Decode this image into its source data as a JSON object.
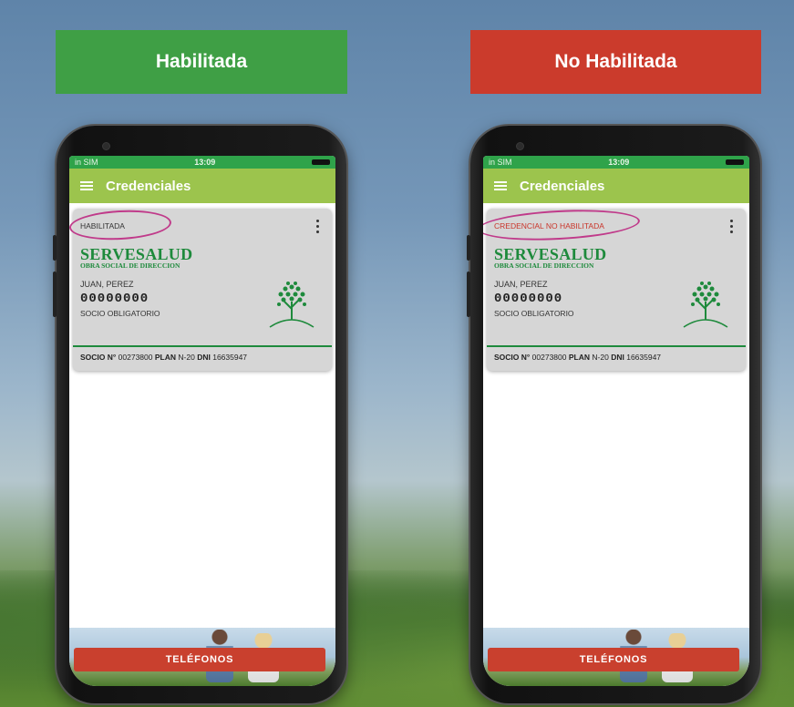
{
  "banners": {
    "enabled": "Habilitada",
    "disabled": "No Habilitada"
  },
  "colors": {
    "enabled_green": "#3f9f45",
    "disabled_red": "#cb3b2c",
    "appbar": "#9cc44d",
    "brand_green": "#1e8a3c",
    "highlight_oval": "#c03a8a"
  },
  "phones": [
    {
      "status": {
        "carrier": "in SIM",
        "time": "13:09"
      },
      "appbar": {
        "menu_icon": "hamburger-icon",
        "title": "Credenciales"
      },
      "card": {
        "state_label": "HABILITADA",
        "brand": "SERVESALUD",
        "brand_sub": "OBRA SOCIAL DE DIRECCION",
        "member_name": "JUAN, PEREZ",
        "member_number": "00000000",
        "member_type": "SOCIO OBLIGATORIO",
        "footer": {
          "socio_label": "SOCIO N°",
          "socio_value": "00273800",
          "plan_label": "PLAN",
          "plan_value": "N-20",
          "dni_label": "DNI",
          "dni_value": "16635947"
        }
      },
      "phones_button": "TELÉFONOS"
    },
    {
      "status": {
        "carrier": "in SIM",
        "time": "13:09"
      },
      "appbar": {
        "menu_icon": "hamburger-icon",
        "title": "Credenciales"
      },
      "card": {
        "state_label": "CREDENCIAL NO HABILITADA",
        "brand": "SERVESALUD",
        "brand_sub": "OBRA SOCIAL DE DIRECCION",
        "member_name": "JUAN, PEREZ",
        "member_number": "00000000",
        "member_type": "SOCIO OBLIGATORIO",
        "footer": {
          "socio_label": "SOCIO N°",
          "socio_value": "00273800",
          "plan_label": "PLAN",
          "plan_value": "N-20",
          "dni_label": "DNI",
          "dni_value": "16635947"
        }
      },
      "phones_button": "TELÉFONOS"
    }
  ]
}
